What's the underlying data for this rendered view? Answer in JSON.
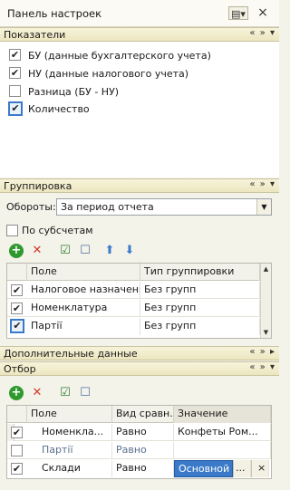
{
  "window": {
    "title": "Панель настроек",
    "controls": {
      "menu": "▤▾",
      "close": "×"
    }
  },
  "sections": {
    "indicators": {
      "title": "Показатели",
      "controls": "« » ▾",
      "items": [
        {
          "label": "БУ (данные бухгалтерского учета)",
          "checked": true,
          "check": "✔"
        },
        {
          "label": "НУ (данные налогового учета)",
          "checked": true,
          "check": "✔"
        },
        {
          "label": "Разница (БУ - НУ)",
          "checked": false,
          "check": ""
        },
        {
          "label": "Количество",
          "checked": true,
          "check": "✔"
        }
      ]
    },
    "grouping": {
      "title": "Группировка",
      "controls": "« » ▾",
      "turnover_label": "Обороты:",
      "turnover_value": "За период отчета",
      "subaccounts_label": "По субсчетам",
      "columns": {
        "field": "Поле",
        "type": "Тип группировки"
      },
      "rows": [
        {
          "check": "✔",
          "field": "Налоговое назначение",
          "type": "Без групп"
        },
        {
          "check": "✔",
          "field": "Номенклатура",
          "type": "Без групп"
        },
        {
          "check": "✔",
          "field": "Партії",
          "type": "Без групп"
        }
      ]
    },
    "additional": {
      "title": "Дополнительные данные",
      "controls": "« » ▸"
    },
    "filter": {
      "title": "Отбор",
      "controls": "« » ▾",
      "columns": {
        "field": "Поле",
        "compare": "Вид сравн...",
        "value": "Значение"
      },
      "rows": [
        {
          "check": "✔",
          "field": "Номенкла...",
          "compare": "Равно",
          "value": "Конфеты Ром..."
        },
        {
          "check": "",
          "field": "Партії",
          "compare": "Равно",
          "value": ""
        },
        {
          "check": "✔",
          "field": "Склади",
          "compare": "Равно",
          "value": "Основной с"
        }
      ]
    }
  },
  "icons": {
    "add": "+",
    "delete": "✕",
    "check_all": "☑",
    "uncheck_all": "☐",
    "move_up": "⬆",
    "move_down": "⬇",
    "ellipsis": "...",
    "clear": "×"
  },
  "colors": {
    "accent": "#3b7ac9",
    "section_header": "#ece6bf",
    "add_green": "#2e9a2e",
    "delete_red": "#d23a2a",
    "arrow_blue": "#3b7ac9"
  }
}
